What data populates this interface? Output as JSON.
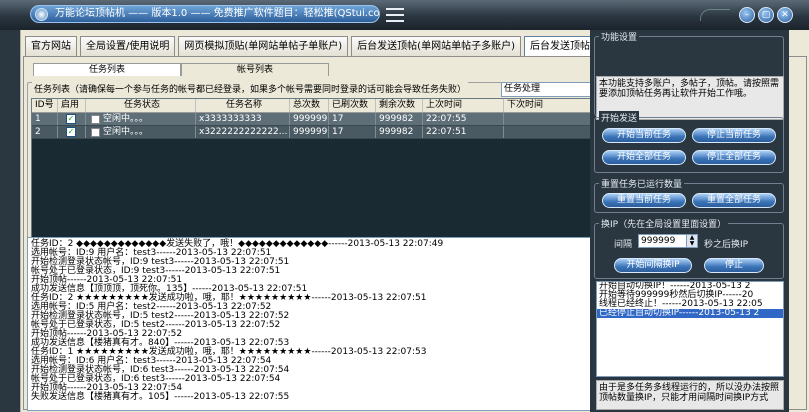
{
  "window": {
    "title": "万能论坛顶帖机 —— 版本1.0 —— 免费推广软件题目：轻松推(QStui.com)"
  },
  "tabs": [
    "官方网站",
    "全局设置/使用说明",
    "网页模拟顶贴(单网站单帖子单账户)",
    "后台发送顶帖(单网站单帖子多账户)",
    "后台发送顶帖(多网站多帖子多账户)"
  ],
  "subtabs": [
    "任务列表",
    "帐号列表"
  ],
  "task_group": {
    "title": "任务列表（请确保每一个参与任务的帐号都已经登录，如果多个帐号需要同时登录的话可能会导致任务失败）",
    "select_value": "任务处理",
    "columns": [
      "ID号",
      "启用",
      "任务状态",
      "任务名称",
      "总次数",
      "已刷次数",
      "剩余次数",
      "上次时间",
      "下次时间"
    ],
    "rows": [
      {
        "id": "1",
        "enabled": "✓",
        "status": "空闲中。。。",
        "name": "x3333333333",
        "total": "999999",
        "done": "17",
        "remain": "999982",
        "last": "22:07:55",
        "next": ""
      },
      {
        "id": "2",
        "enabled": "✓",
        "status": "空闲中。。。",
        "name": "x3222222222222...",
        "total": "999999",
        "done": "17",
        "remain": "999982",
        "last": "22:07:51",
        "next": ""
      }
    ]
  },
  "log_lines": [
    "任务ID：2 ◆◆◆◆◆◆◆◆◆◆◆◆◆发送失败了，哦！◆◆◆◆◆◆◆◆◆◆◆◆◆------2013-05-13 22:07:49",
    "选用帐号：ID:9 用户名：test3------2013-05-13 22:07:51",
    "开始检测登录状态帐号，ID:9 test3------2013-05-13 22:07:51",
    "帐号处于已登录状态，ID:9 test3------2013-05-13 22:07:51",
    "开始顶帖------2013-05-13 22:07:51",
    "成功发送信息【顶顶顶，顶死你。135】------2013-05-13 22:07:51",
    "任务ID：2 ★★★★★★★★★发送成功啦，哦，耶！★★★★★★★★★------2013-05-13 22:07:51",
    "选用帐号：ID:5 用户名：test2------2013-05-13 22:07:52",
    "开始检测登录状态帐号，ID:5 test2------2013-05-13 22:07:52",
    "帐号处于已登录状态，ID:5 test2------2013-05-13 22:07:52",
    "开始顶帖------2013-05-13 22:07:52",
    "成功发送信息【楼猪真有才。840】------2013-05-13 22:07:53",
    "任务ID：1 ★★★★★★★★★发送成功啦，哦，耶！★★★★★★★★★------2013-05-13 22:07:53",
    "选用帐号：ID:6 用户名：test3------2013-05-13 22:07:54",
    "开始检测登录状态帐号，ID:6 test3------2013-05-13 22:07:54",
    "帐号处于已登录状态，ID:6 test3------2013-05-13 22:07:54",
    "开始顶帖------2013-05-13 22:07:54",
    "失败发送信息【楼猪真有才。105】------2013-05-13 22:07:55"
  ],
  "right": {
    "func_title": "功能设置",
    "func_info": "本功能支持多账户，多帖子，顶帖。请按照需要添加顶帖任务再让软件开始工作哦。",
    "start_title": "开始发送",
    "btn_start_current": "开始当前任务",
    "btn_stop_current": "停止当前任务",
    "btn_start_all": "开始全部任务",
    "btn_stop_all": "停止全部任务",
    "reset_title": "重置任务已运行数量",
    "btn_reset_current": "重置当前任务",
    "btn_reset_all": "重置全部任务",
    "ip_title": "换IP（先在全局设置里面设置）",
    "interval_label": "间隔",
    "interval_value": "999999",
    "interval_suffix": "秒之后换IP",
    "btn_start_ip": "开始间隔换IP",
    "btn_stop_ip": "停止",
    "ip_log": [
      "开始自动切换IP！------2013-05-13 2",
      "开始等待999999秒然后切换IP------20",
      "线程已经终止！------2013-05-13 22:05",
      "已经停止自动切换IP------2013-05-13 2"
    ],
    "note": "由于是多任务多线程运行的，所以没办法按照顶帖数量换IP，只能才用间隔时间换IP方式"
  }
}
